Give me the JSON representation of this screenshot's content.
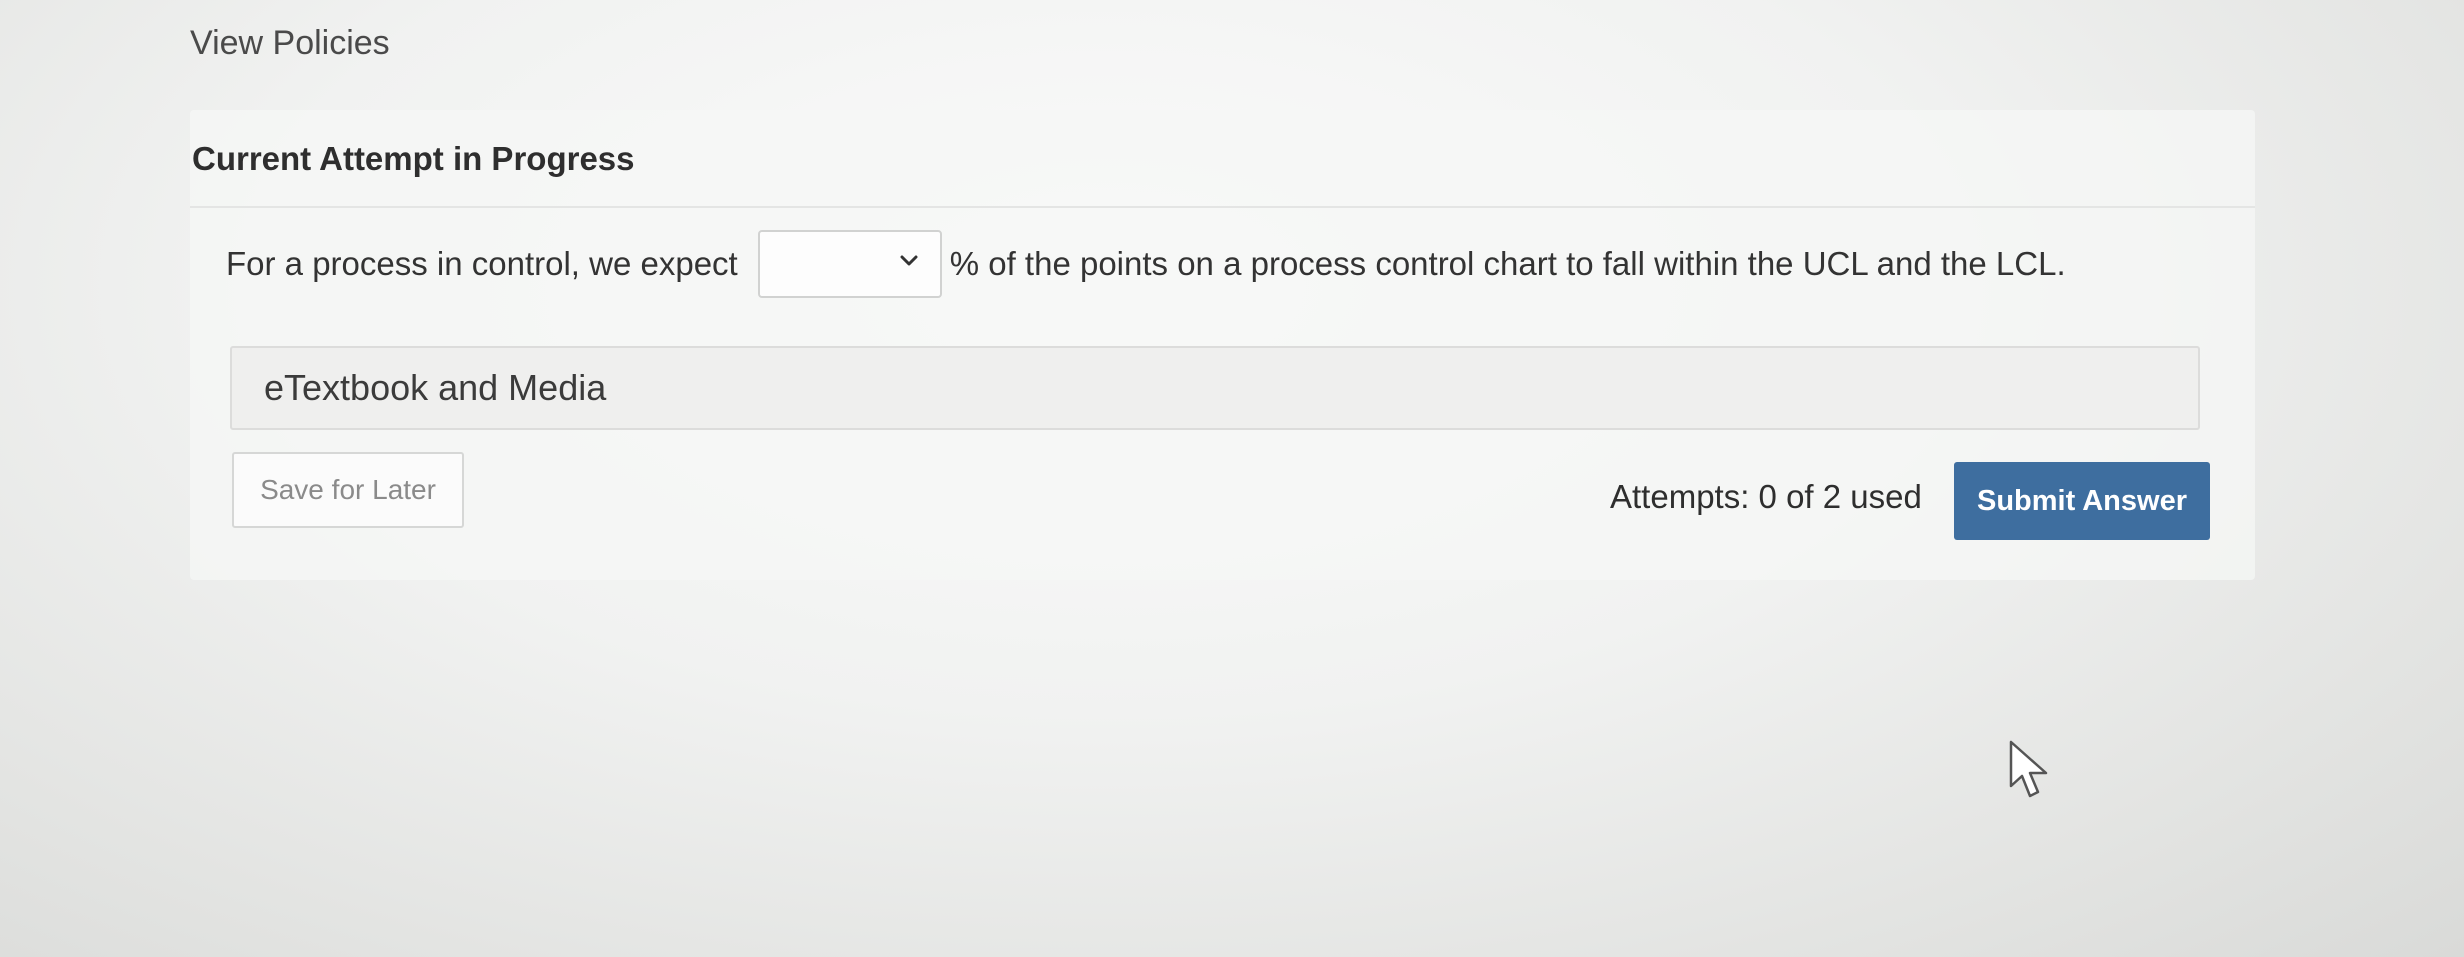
{
  "header": {
    "view_policies_label": "View Policies"
  },
  "panel": {
    "title": "Current Attempt in Progress"
  },
  "question": {
    "text_before": "For a process in control, we expect",
    "select_value": "",
    "text_after": "% of the points on a process control chart to fall within the UCL and the LCL."
  },
  "resources": {
    "etextbook_label": "eTextbook and Media"
  },
  "footer": {
    "save_label": "Save for Later",
    "attempts_text": "Attempts: 0 of 2 used",
    "submit_label": "Submit Answer"
  },
  "colors": {
    "submit_button": "#3e6e9f",
    "panel_background": "#f6f7f6"
  },
  "icons": {
    "dropdown": "chevron-down-icon",
    "pointer": "mouse-cursor-icon"
  }
}
